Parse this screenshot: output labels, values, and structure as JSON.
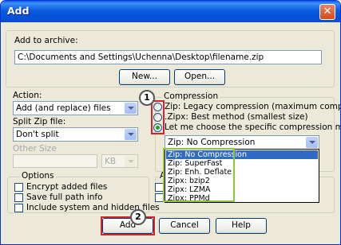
{
  "window": {
    "title": "Add",
    "close_glyph": "✕"
  },
  "archive": {
    "group_label": "Add to archive:",
    "path_value": "C:\\Documents and Settings\\Uchenna\\Desktop\\filename.zip",
    "new_button": "New...",
    "open_button": "Open..."
  },
  "action": {
    "label": "Action:",
    "value": "Add (and replace) files",
    "split_label": "Split Zip file:",
    "split_value": "Don't split",
    "other_size_label": "Other Size",
    "unit_value": "KB"
  },
  "compression": {
    "label": "Compression",
    "option1": "Zip: Legacy compression (maximum compatibility)",
    "option2": ".Zipx: Best method (smallest size)",
    "option3": "Let me choose the specific compression method",
    "selected_method": "Zip: No Compression",
    "methods": [
      "Zip: No Compression",
      "Zip: SuperFast",
      "Zip: Enh. Deflate",
      "Zipx: bzip2",
      "Zipx: LZMA",
      "Zipx: PPMd"
    ]
  },
  "options": {
    "label": "Options",
    "encrypt": "Encrypt added files",
    "save_path": "Save full path info",
    "include_hidden": "Include system and hidden files",
    "partial_label": "A"
  },
  "buttons": {
    "add": "Add",
    "cancel": "Cancel",
    "help": "Help"
  },
  "callouts": {
    "one": "1",
    "two": "2"
  },
  "colors": {
    "titlebar": "#0a5fe6",
    "callout_red": "#d4232c",
    "callout_green": "#8fc43d",
    "selection": "#316ac5"
  }
}
